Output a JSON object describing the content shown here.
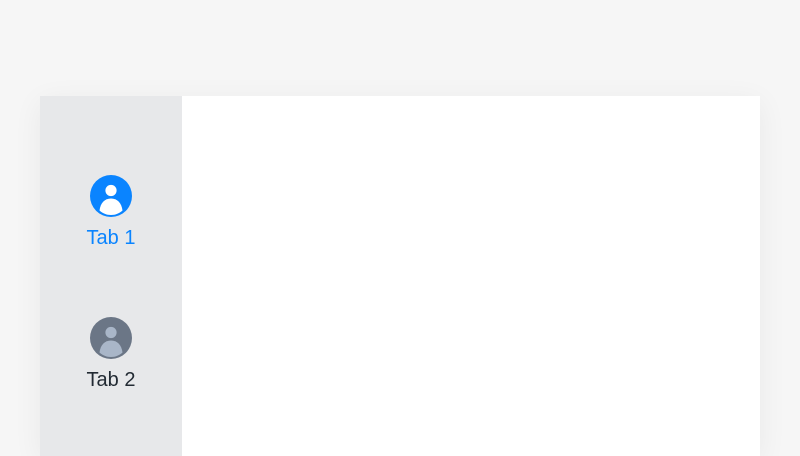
{
  "tabs": [
    {
      "label": "Tab 1",
      "icon": "user-avatar-icon",
      "active": true
    },
    {
      "label": "Tab 2",
      "icon": "user-avatar-icon",
      "active": false
    }
  ],
  "colors": {
    "active": "#0a84ff",
    "inactive_icon": "#6b7686",
    "text": "#222a33",
    "rail_bg": "#e7e8ea",
    "page_bg": "#f6f6f6"
  }
}
